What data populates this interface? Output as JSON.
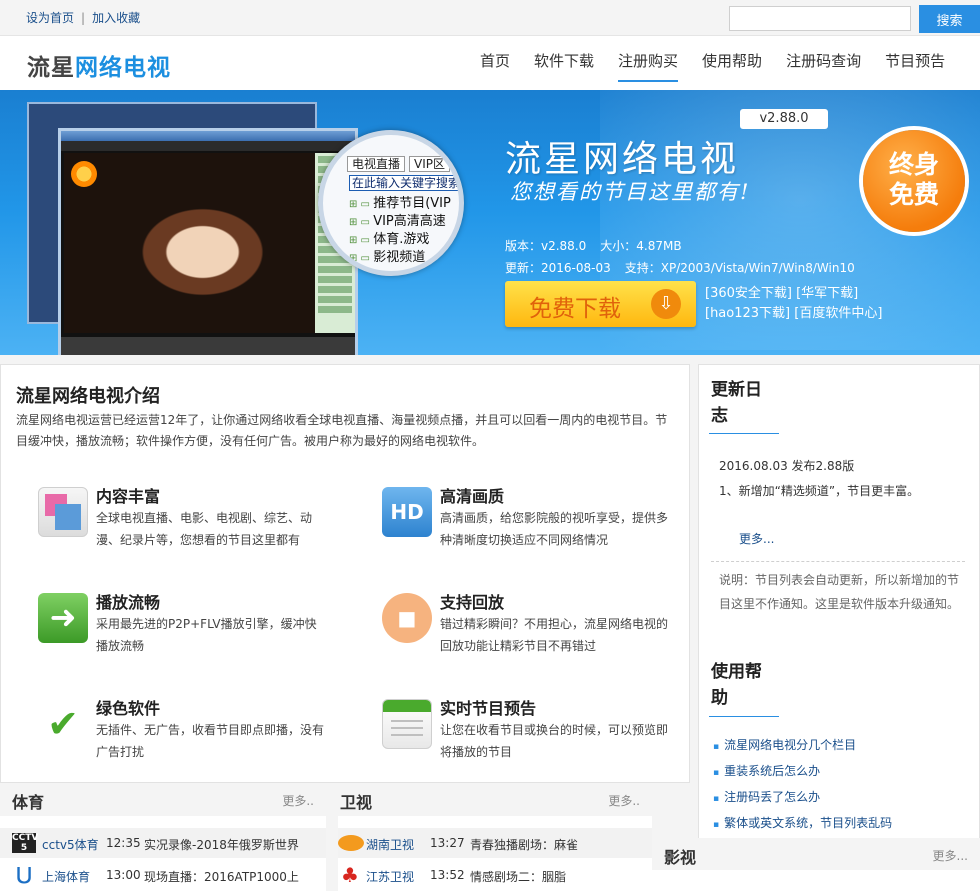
{
  "topbar": {
    "set_home": "设为首页",
    "separator": "|",
    "add_fav": "加入收藏",
    "search_placeholder": "",
    "search_button": "搜索"
  },
  "header": {
    "logo_part1": "流星",
    "logo_part2": "网络电视",
    "nav": [
      "首页",
      "软件下载",
      "注册购买",
      "使用帮助",
      "注册码查询",
      "节目预告"
    ],
    "active_nav": "注册购买"
  },
  "banner": {
    "version_tag": "v2.88.0",
    "title": "流星网络电视",
    "slogan": "您想看的节目这里都有!",
    "version_label": "版本：v2.88.0",
    "size_label": "大小：4.87MB",
    "update_label": "更新：2016-08-03",
    "support_label": "支持：XP/2003/Vista/Win7/Win8/Win10",
    "badge_line1": "终身",
    "badge_line2": "免费",
    "download_button": "免费下载",
    "download_arrow": "⇩",
    "mirrors": [
      "[360安全下载]",
      "[华军下载]",
      "[hao123下载]",
      "[百度软件中心]"
    ],
    "magnifier": {
      "tab1": "电视直播",
      "tab2": "VIP区",
      "search": "在此输入关键字搜索",
      "items": [
        "推荐节目(VIP",
        "VIP高清高速",
        "体育.游戏",
        "影视频道"
      ]
    }
  },
  "intro": {
    "title": "流星网络电视介绍",
    "description": "流星网络电视运营已经运营12年了，让你通过网络收看全球电视直播、海量视频点播，并且可以回看一周内的电视节目。节目缓冲快，播放流畅；软件操作方便，没有任何广告。被用户称为最好的网络电视软件。",
    "features": [
      {
        "title": "内容丰富",
        "desc": "全球电视直播、电影、电视剧、综艺、动漫、纪录片等，您想看的节目这里都有",
        "icon": "content-icon"
      },
      {
        "title": "高清画质",
        "desc": "高清画质，给您影院般的视听享受，提供多种清晰度切换适应不同网络情况",
        "icon": "hd-icon",
        "icon_text": "HD"
      },
      {
        "title": "播放流畅",
        "desc": "采用最先进的P2P+FLV播放引擎，缓冲快播放流畅",
        "icon": "play-arrow-icon",
        "icon_text": "➜"
      },
      {
        "title": "支持回放",
        "desc": "错过精彩瞬间？不用担心，流星网络电视的回放功能让精彩节目不再错过",
        "icon": "replay-camera-icon",
        "icon_text": "■"
      },
      {
        "title": "绿色软件",
        "desc": "无插件、无广告，收看节目即点即播，没有广告打扰",
        "icon": "shield-check-icon",
        "icon_text": "✔"
      },
      {
        "title": "实时节目预告",
        "desc": "让您在收看节目或换台的时候，可以预览即将播放的节目",
        "icon": "schedule-icon"
      }
    ]
  },
  "sidebar": {
    "changelog_title_l1": "更新日",
    "changelog_title_l2": "志",
    "log_date": "2016.08.03 发布2.88版",
    "log_item": "1、新增加“精选频道”，节目更丰富。",
    "more": "更多...",
    "note": "说明：节目列表会自动更新，所以新增加的节目这里不作通知。这里是软件版本升级通知。",
    "help_title_l1": "使用帮",
    "help_title_l2": "助",
    "help_links": [
      "流星网络电视分几个栏目",
      "重装系统后怎么办",
      "注册码丢了怎么办",
      "繁体或英文系统，节目列表乱码"
    ]
  },
  "sports": {
    "title": "体育",
    "more": "更多..",
    "rows": [
      {
        "logo": "CCTV 5",
        "name": "cctv5体育",
        "time": "12:35",
        "program": "实况录像-2018年俄罗斯世界"
      },
      {
        "logo": "⋃",
        "name": "上海体育",
        "time": "13:00",
        "program": "现场直播：2016ATP1000上"
      }
    ]
  },
  "satellite": {
    "title": "卫视",
    "more": "更多..",
    "rows": [
      {
        "logo": "",
        "name": "湖南卫视",
        "time": "13:27",
        "program": "青春独播剧场：麻雀"
      },
      {
        "logo": "♣",
        "name": "江苏卫视",
        "time": "13:52",
        "program": "情感剧场二：胭脂"
      }
    ]
  },
  "movies": {
    "title": "影视",
    "more": "更多..."
  }
}
